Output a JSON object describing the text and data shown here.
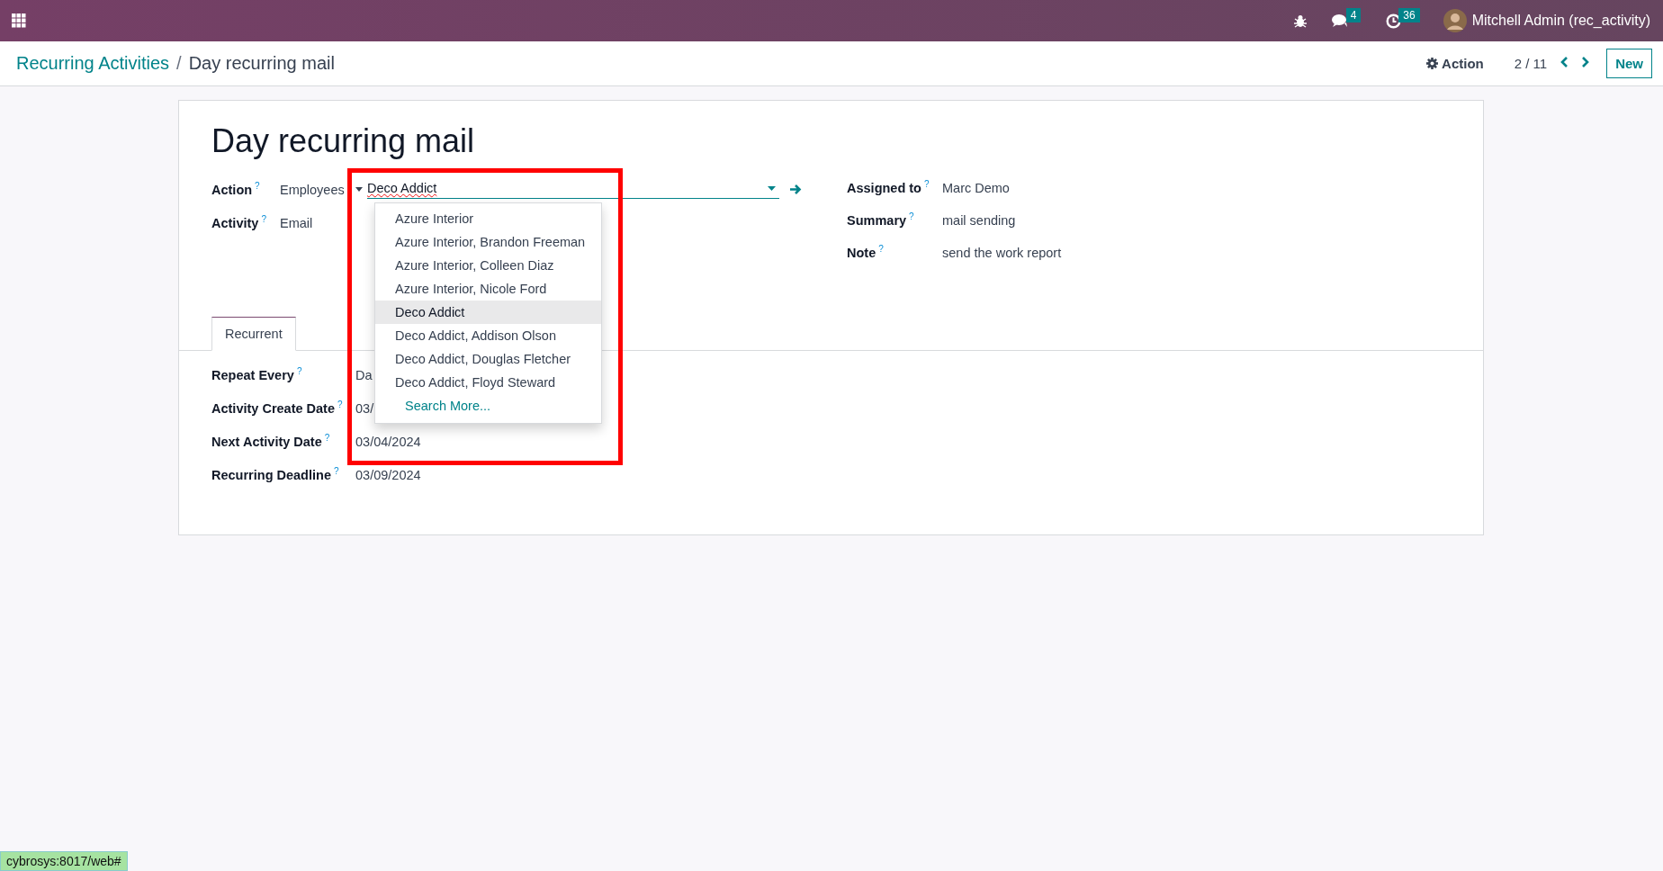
{
  "navbar": {
    "user": "Mitchell Admin (rec_activity)",
    "messages_badge": "4",
    "activities_badge": "36"
  },
  "breadcrumb": {
    "parent": "Recurring Activities",
    "separator": "/",
    "current": "Day recurring mail"
  },
  "control_panel": {
    "action": "Action",
    "pager": "2 / 11",
    "new_button": "New"
  },
  "form": {
    "title": "Day recurring mail",
    "left_fields": [
      {
        "label": "Action",
        "help": "?",
        "kind": "reference",
        "model": "Employees",
        "value": "Deco Addict"
      },
      {
        "label": "Activity",
        "help": "?",
        "kind": "text",
        "value": "Email"
      }
    ],
    "right_fields": [
      {
        "label": "Assigned to",
        "help": "?",
        "kind": "text",
        "value": "Marc Demo"
      },
      {
        "label": "Summary",
        "help": "?",
        "kind": "text",
        "value": "mail sending"
      },
      {
        "label": "Note",
        "help": "?",
        "kind": "text",
        "value": "send the work report"
      }
    ],
    "tabs": [
      {
        "label": "Recurrent",
        "selected": true
      }
    ],
    "tab_fields": [
      {
        "label": "Repeat Every",
        "help": "?",
        "kind": "text",
        "value": "Da"
      },
      {
        "label": "Activity Create Date",
        "help": "?",
        "kind": "text",
        "value": "03/"
      },
      {
        "label": "Next Activity Date",
        "help": "?",
        "kind": "text",
        "value": "03/04/2024"
      },
      {
        "label": "Recurring Deadline",
        "help": "?",
        "kind": "text",
        "value": "03/09/2024"
      }
    ]
  },
  "dropdown": {
    "items": [
      {
        "label": "Azure Interior",
        "selected": false
      },
      {
        "label": "Azure Interior, Brandon Freeman",
        "selected": false
      },
      {
        "label": "Azure Interior, Colleen Diaz",
        "selected": false
      },
      {
        "label": "Azure Interior, Nicole Ford",
        "selected": false
      },
      {
        "label": "Deco Addict",
        "selected": true
      },
      {
        "label": "Deco Addict, Addison Olson",
        "selected": false
      },
      {
        "label": "Deco Addict, Douglas Fletcher",
        "selected": false
      },
      {
        "label": "Deco Addict, Floyd Steward",
        "selected": false
      }
    ],
    "search_more": "Search More..."
  },
  "status_url": "cybrosys:8017/web#"
}
